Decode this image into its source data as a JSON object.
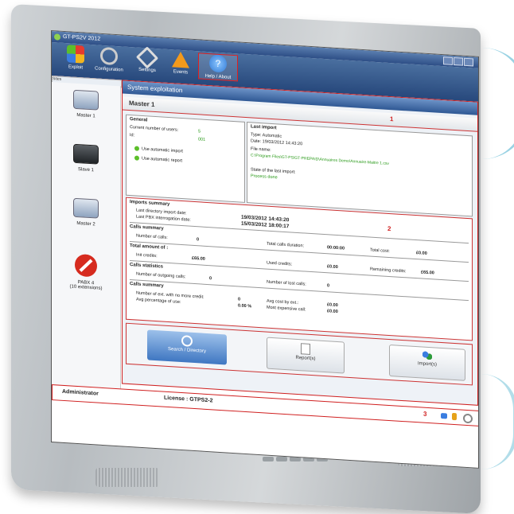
{
  "window": {
    "title": "GT-PS2V 2012"
  },
  "toolbar": {
    "items": [
      {
        "label": "Exploit",
        "icon": "puzzle-icon"
      },
      {
        "label": "Configuration",
        "icon": "gears-icon"
      },
      {
        "label": "Settings",
        "icon": "wrench-icon"
      },
      {
        "label": "Events",
        "icon": "warning-icon"
      },
      {
        "label": "Help / About",
        "icon": "help-icon"
      }
    ]
  },
  "sidebar": {
    "label": "Sites",
    "sites": [
      {
        "name": "Master 1",
        "icon": "switch-device-icon"
      },
      {
        "name": "Slave 1",
        "icon": "router-device-icon"
      },
      {
        "name": "Master 2",
        "icon": "switch-device-icon"
      },
      {
        "name": "PABX 4",
        "sub": "(10 extensions)",
        "icon": "blocked-icon"
      }
    ]
  },
  "main": {
    "header": "System exploitation",
    "site_title": "Master 1",
    "general": {
      "title": "General",
      "users_label": "Current number of users:",
      "users_value": "5",
      "id_label": "Id:",
      "id_value": "001",
      "opt1": "Use automatic import",
      "opt2": "Use automatic report"
    },
    "last_import": {
      "title": "Last import",
      "type": "Type:  Automatic",
      "date": "Date:  19/03/2012 14:43:20",
      "file_label": "File name:",
      "file_path": "C:\\Program Files\\GT-PS\\GT-PREPAID\\Annuaires Demo\\Annuaire-Maitre 1.csv",
      "state_label": "State of the last import:",
      "state_value": "Process done"
    },
    "marker1": "1",
    "marker2": "2",
    "marker3": "3",
    "imports": {
      "title": "Imports summary",
      "dir_label": "Last directory import date:",
      "dir_value": "19/03/2012 14:43:20",
      "pbx_label": "Last PBX interrogation date:",
      "pbx_value": "15/03/2012 18:00:17"
    },
    "calls_summary": {
      "title": "Calls summary",
      "num_label": "Number of calls:",
      "num_value": "0",
      "dur_label": "Total calls duration:",
      "dur_value": "00:00:00",
      "cost_label": "Total cost:",
      "cost_value": "£0.00"
    },
    "amount": {
      "title": "Total amount of :",
      "init_label": "Init credits:",
      "init_value": "£65.00",
      "used_label": "Used credits:",
      "used_value": "£0.00",
      "rem_label": "Remaining credits:",
      "rem_value": "£65.00"
    },
    "stats": {
      "title": "Calls statistics",
      "out_label": "Number of outgoing calls:",
      "out_value": "0",
      "lost_label": "Number of lost calls:",
      "lost_value": "0"
    },
    "calls_summary2": {
      "title": "Calls summary",
      "nocredit_label": "Number of ext. with no more credit:",
      "nocredit_value": "0",
      "avgcost_label": "Avg cost by ext.:",
      "avgcost_value": "£0.00",
      "avgpct_label": "Avg percentage of use:",
      "avgpct_value": "0.00 %",
      "expens_label": "Most expensive call:",
      "expens_value": "£0.00"
    },
    "buttons": {
      "search": "Search / Directory",
      "reports": "Report(s)",
      "imports": "Import(s)"
    }
  },
  "status": {
    "user": "Administrator",
    "license": "License : GTPS2-2"
  },
  "colors": {
    "accent": "#2f5894",
    "marker": "#d02020",
    "value_green": "#2a9a1a"
  }
}
